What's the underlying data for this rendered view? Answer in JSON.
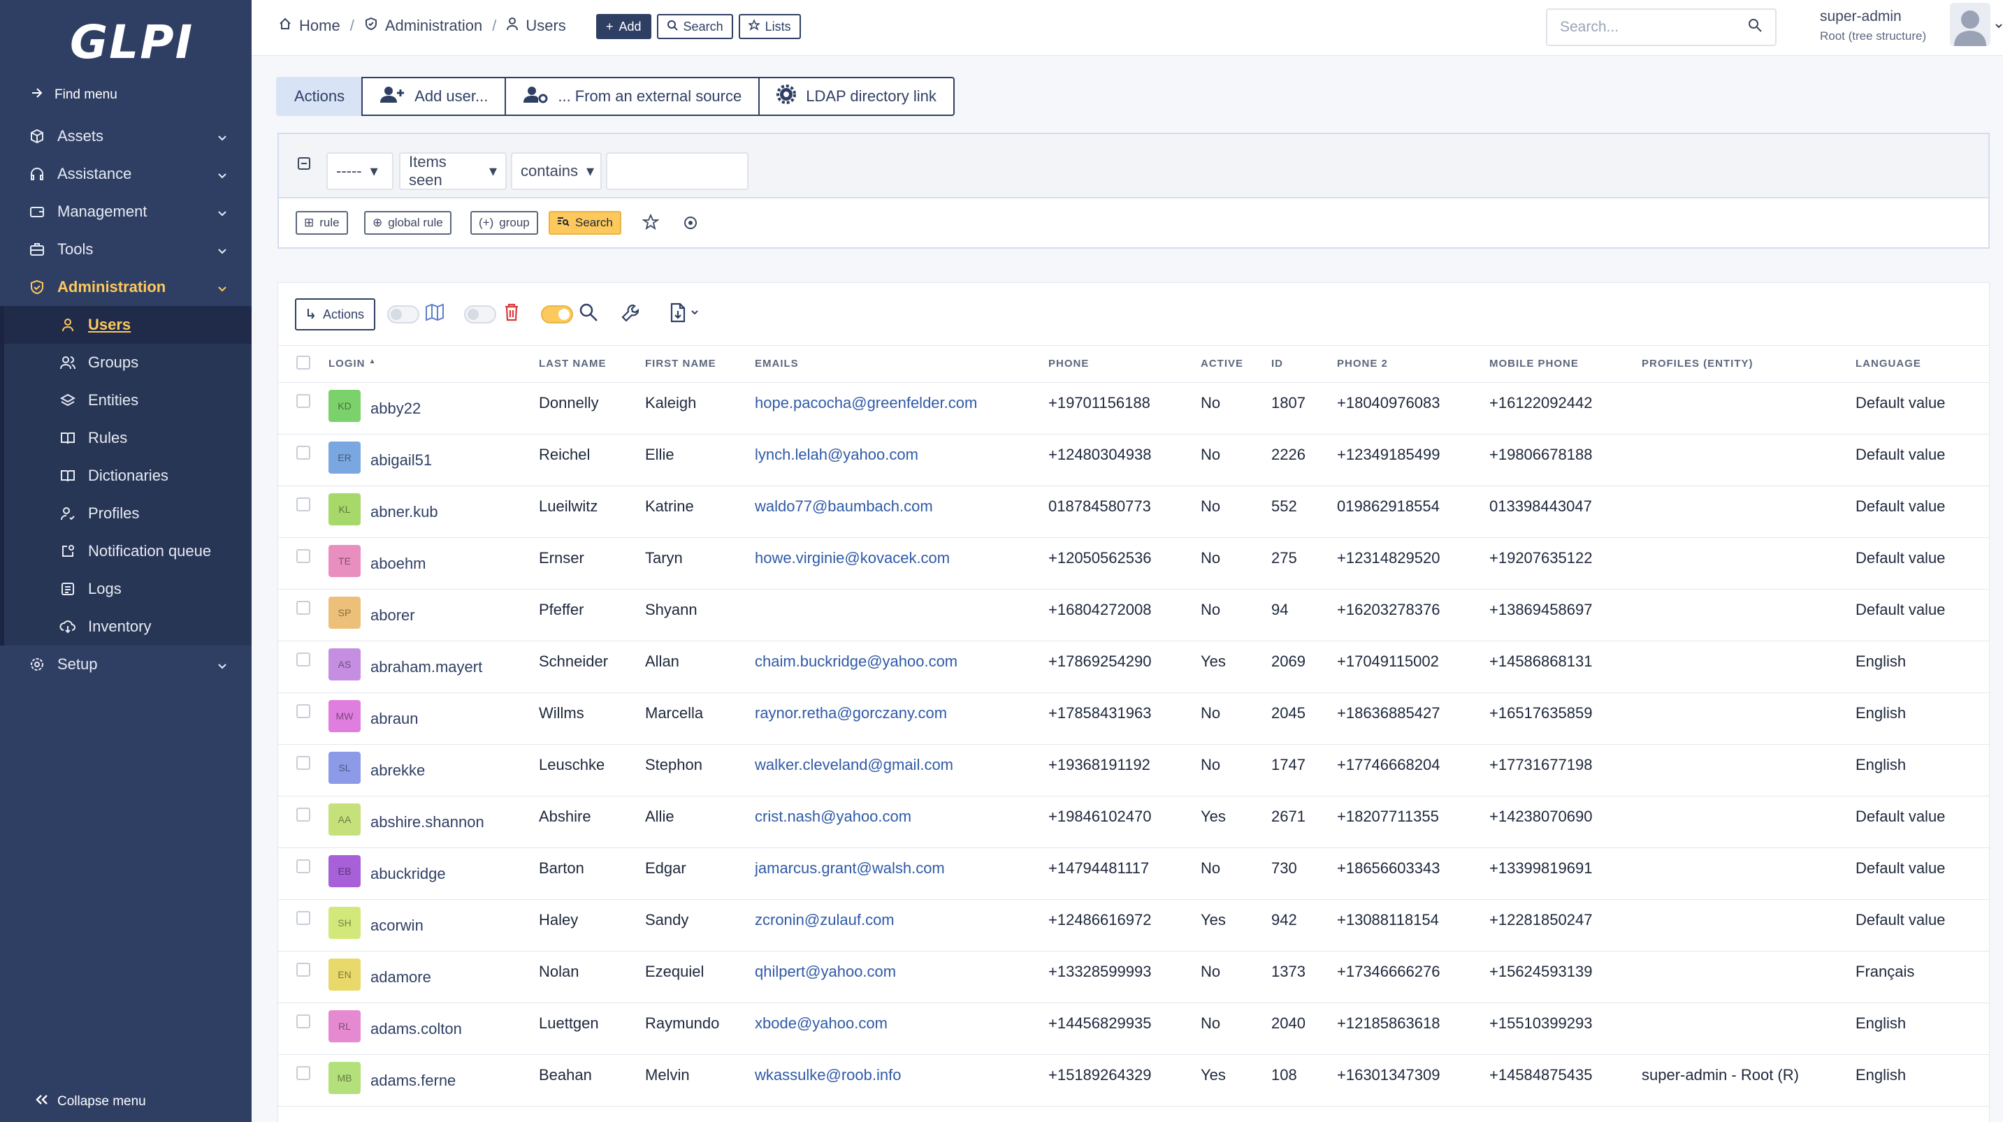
{
  "sidebar": {
    "logo": "GLPI",
    "find_menu": "Find menu",
    "items": [
      {
        "label": "Assets",
        "icon": "box-icon"
      },
      {
        "label": "Assistance",
        "icon": "headset-icon"
      },
      {
        "label": "Management",
        "icon": "wallet-icon"
      },
      {
        "label": "Tools",
        "icon": "briefcase-icon"
      },
      {
        "label": "Administration",
        "icon": "shield-icon"
      }
    ],
    "submenu": [
      {
        "label": "Users",
        "icon": "user-icon"
      },
      {
        "label": "Groups",
        "icon": "users-icon"
      },
      {
        "label": "Entities",
        "icon": "stack-icon"
      },
      {
        "label": "Rules",
        "icon": "book-icon"
      },
      {
        "label": "Dictionaries",
        "icon": "book-icon"
      },
      {
        "label": "Profiles",
        "icon": "user-check-icon"
      },
      {
        "label": "Notification queue",
        "icon": "notification-icon"
      },
      {
        "label": "Logs",
        "icon": "news-icon"
      },
      {
        "label": "Inventory",
        "icon": "cloud-download-icon"
      }
    ],
    "setup": {
      "label": "Setup",
      "icon": "gear-icon"
    },
    "collapse": "Collapse menu"
  },
  "header": {
    "breadcrumb": [
      "Home",
      "Administration",
      "Users"
    ],
    "buttons": {
      "add": "Add",
      "search": "Search",
      "lists": "Lists"
    },
    "search_placeholder": "Search...",
    "user_name": "super-admin",
    "user_entity": "Root (tree structure)"
  },
  "action_tabs": [
    "Actions",
    "Add user...",
    "... From an external source",
    "LDAP directory link"
  ],
  "criteria": {
    "field1": "-----",
    "field2": "Items seen",
    "operator": "contains",
    "value": "",
    "buttons": {
      "rule": "rule",
      "global_rule": "global rule",
      "group": "group",
      "search": "Search"
    }
  },
  "results": {
    "actions_label": "Actions",
    "columns": [
      "Login",
      "Last name",
      "First name",
      "Emails",
      "Phone",
      "Active",
      "ID",
      "Phone 2",
      "Mobile phone",
      "Profiles (Entity)",
      "Language"
    ],
    "rows": [
      {
        "initials": "KD",
        "color": "#7bd16b",
        "login": "abby22",
        "last": "Donnelly",
        "first": "Kaleigh",
        "email": "hope.pacocha@greenfelder.com",
        "phone": "+19701156188",
        "active": "No",
        "id": "1807",
        "phone2": "+18040976083",
        "mobile": "+16122092442",
        "profiles": "",
        "language": "Default value"
      },
      {
        "initials": "ER",
        "color": "#7aa7e0",
        "login": "abigail51",
        "last": "Reichel",
        "first": "Ellie",
        "email": "lynch.lelah@yahoo.com",
        "phone": "+12480304938",
        "active": "No",
        "id": "2226",
        "phone2": "+12349185499",
        "mobile": "+19806678188",
        "profiles": "",
        "language": "Default value"
      },
      {
        "initials": "KL",
        "color": "#a7d86a",
        "login": "abner.kub",
        "last": "Lueilwitz",
        "first": "Katrine",
        "email": "waldo77@baumbach.com",
        "phone": "018784580773",
        "active": "No",
        "id": "552",
        "phone2": "019862918554",
        "mobile": "013398443047",
        "profiles": "",
        "language": "Default value"
      },
      {
        "initials": "TE",
        "color": "#e88fc0",
        "login": "aboehm",
        "last": "Ernser",
        "first": "Taryn",
        "email": "howe.virginie@kovacek.com",
        "phone": "+12050562536",
        "active": "No",
        "id": "275",
        "phone2": "+12314829520",
        "mobile": "+19207635122",
        "profiles": "",
        "language": "Default value"
      },
      {
        "initials": "SP",
        "color": "#edc07a",
        "login": "aborer",
        "last": "Pfeffer",
        "first": "Shyann",
        "email": "",
        "phone": "+16804272008",
        "active": "No",
        "id": "94",
        "phone2": "+16203278376",
        "mobile": "+13869458697",
        "profiles": "",
        "language": "Default value"
      },
      {
        "initials": "AS",
        "color": "#c58ee0",
        "login": "abraham.mayert",
        "last": "Schneider",
        "first": "Allan",
        "email": "chaim.buckridge@yahoo.com",
        "phone": "+17869254290",
        "active": "Yes",
        "id": "2069",
        "phone2": "+17049115002",
        "mobile": "+14586868131",
        "profiles": "",
        "language": "English"
      },
      {
        "initials": "MW",
        "color": "#e07ee0",
        "login": "abraun",
        "last": "Willms",
        "first": "Marcella",
        "email": "raynor.retha@gorczany.com",
        "phone": "+17858431963",
        "active": "No",
        "id": "2045",
        "phone2": "+18636885427",
        "mobile": "+16517635859",
        "profiles": "",
        "language": "English"
      },
      {
        "initials": "SL",
        "color": "#8d9ae8",
        "login": "abrekke",
        "last": "Leuschke",
        "first": "Stephon",
        "email": "walker.cleveland@gmail.com",
        "phone": "+19368191192",
        "active": "No",
        "id": "1747",
        "phone2": "+17746668204",
        "mobile": "+17731677198",
        "profiles": "",
        "language": "English"
      },
      {
        "initials": "AA",
        "color": "#c6e07a",
        "login": "abshire.shannon",
        "last": "Abshire",
        "first": "Allie",
        "email": "crist.nash@yahoo.com",
        "phone": "+19846102470",
        "active": "Yes",
        "id": "2671",
        "phone2": "+18207711355",
        "mobile": "+14238070690",
        "profiles": "",
        "language": "Default value"
      },
      {
        "initials": "EB",
        "color": "#a760d8",
        "login": "abuckridge",
        "last": "Barton",
        "first": "Edgar",
        "email": "jamarcus.grant@walsh.com",
        "phone": "+14794481117",
        "active": "No",
        "id": "730",
        "phone2": "+18656603343",
        "mobile": "+13399819691",
        "profiles": "",
        "language": "Default value"
      },
      {
        "initials": "SH",
        "color": "#d3e87a",
        "login": "acorwin",
        "last": "Haley",
        "first": "Sandy",
        "email": "zcronin@zulauf.com",
        "phone": "+12486616972",
        "active": "Yes",
        "id": "942",
        "phone2": "+13088118154",
        "mobile": "+12281850247",
        "profiles": "",
        "language": "Default value"
      },
      {
        "initials": "EN",
        "color": "#e8d96a",
        "login": "adamore",
        "last": "Nolan",
        "first": "Ezequiel",
        "email": "qhilpert@yahoo.com",
        "phone": "+13328599993",
        "active": "No",
        "id": "1373",
        "phone2": "+17346666276",
        "mobile": "+15624593139",
        "profiles": "",
        "language": "Français"
      },
      {
        "initials": "RL",
        "color": "#e58ad0",
        "login": "adams.colton",
        "last": "Luettgen",
        "first": "Raymundo",
        "email": "xbode@yahoo.com",
        "phone": "+14456829935",
        "active": "No",
        "id": "2040",
        "phone2": "+12185863618",
        "mobile": "+15510399293",
        "profiles": "",
        "language": "English"
      },
      {
        "initials": "MB",
        "color": "#b3e07a",
        "login": "adams.ferne",
        "last": "Beahan",
        "first": "Melvin",
        "email": "wkassulke@roob.info",
        "phone": "+15189264329",
        "active": "Yes",
        "id": "108",
        "phone2": "+16301347309",
        "mobile": "+14584875435",
        "profiles": "super-admin - Root (R)",
        "language": "English"
      }
    ]
  }
}
